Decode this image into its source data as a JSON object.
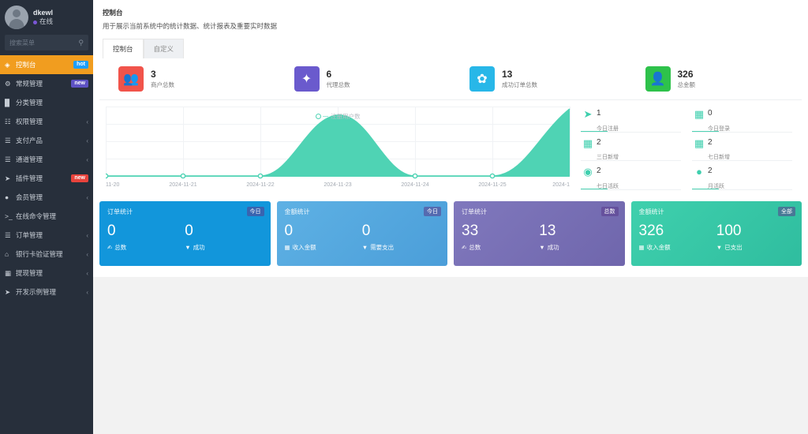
{
  "sidebar": {
    "user": {
      "name": "dkewl",
      "status": "在线",
      "status_color": "#7a56d6"
    },
    "search": {
      "placeholder": "搜索菜单",
      "icon": "search-icon"
    },
    "items": [
      {
        "label": "控制台",
        "icon": "dashboard-icon",
        "badge": "hot",
        "badge_type": "hot",
        "active": true,
        "caret": ""
      },
      {
        "label": "常规管理",
        "icon": "settings-icon",
        "badge": "new",
        "badge_type": "new-p",
        "active": false,
        "caret": ""
      },
      {
        "label": "分类管理",
        "icon": "tag-icon",
        "badge": "",
        "badge_type": "",
        "active": false,
        "caret": ""
      },
      {
        "label": "权限管理",
        "icon": "key-icon",
        "badge": "",
        "badge_type": "",
        "active": false,
        "caret": "‹"
      },
      {
        "label": "支付产品",
        "icon": "list-icon",
        "badge": "",
        "badge_type": "",
        "active": false,
        "caret": "‹"
      },
      {
        "label": "通道管理",
        "icon": "list-icon",
        "badge": "",
        "badge_type": "",
        "active": false,
        "caret": "‹"
      },
      {
        "label": "插件管理",
        "icon": "plugin-icon",
        "badge": "new",
        "badge_type": "new-r",
        "active": false,
        "caret": ""
      },
      {
        "label": "会员管理",
        "icon": "user-icon",
        "badge": "",
        "badge_type": "",
        "active": false,
        "caret": "‹"
      },
      {
        "label": "在线命令管理",
        "icon": "terminal-icon",
        "badge": "",
        "badge_type": "",
        "active": false,
        "caret": ""
      },
      {
        "label": "订单管理",
        "icon": "list-icon",
        "badge": "",
        "badge_type": "",
        "active": false,
        "caret": "‹"
      },
      {
        "label": "银行卡验证管理",
        "icon": "bank-icon",
        "badge": "",
        "badge_type": "",
        "active": false,
        "caret": "‹"
      },
      {
        "label": "提现管理",
        "icon": "card-icon",
        "badge": "",
        "badge_type": "",
        "active": false,
        "caret": "‹"
      },
      {
        "label": "开发示例管理",
        "icon": "code-icon",
        "badge": "",
        "badge_type": "",
        "active": false,
        "caret": "‹"
      }
    ]
  },
  "header": {
    "title": "控制台",
    "description": "用于展示当前系统中的统计数据、统计报表及重要实时数据",
    "tabs": [
      {
        "label": "控制台",
        "active": true
      },
      {
        "label": "自定义",
        "active": false
      }
    ]
  },
  "stats": [
    {
      "value": "3",
      "label": "商户总数",
      "icon": "users-icon",
      "color": "#f1544b"
    },
    {
      "value": "6",
      "label": "代理总数",
      "icon": "magic-icon",
      "color": "#6a5acd"
    },
    {
      "value": "13",
      "label": "成功订单总数",
      "icon": "leaf-icon",
      "color": "#28b7e8"
    },
    {
      "value": "326",
      "label": "总金额",
      "icon": "person-icon",
      "color": "#2ec24b"
    }
  ],
  "side_stats": [
    {
      "value": "1",
      "label": "今日注册",
      "icon": "rocket-icon"
    },
    {
      "value": "0",
      "label": "今日登录",
      "icon": "idcard-icon"
    },
    {
      "value": "2",
      "label": "三日新增",
      "icon": "calendar-icon"
    },
    {
      "value": "2",
      "label": "七日新增",
      "icon": "calendar-plus-icon"
    },
    {
      "value": "2",
      "label": "七日活跃",
      "icon": "user-circle-icon"
    },
    {
      "value": "2",
      "label": "月活跃",
      "icon": "user-filled-icon"
    }
  ],
  "bottom_cards": [
    {
      "title": "订单统计",
      "tag": "今日",
      "color": "#1296db",
      "gradient": "linear-gradient(135deg,#1296db,#1296db)",
      "left": {
        "value": "0",
        "label": "总数",
        "icon": "order-icon"
      },
      "right": {
        "value": "0",
        "label": "成功",
        "icon": "filter-icon"
      }
    },
    {
      "title": "金额统计",
      "tag": "今日",
      "color": "#54a7e0",
      "gradient": "linear-gradient(135deg,#5eb1e4,#4b9ed9)",
      "left": {
        "value": "0",
        "label": "收入金额",
        "icon": "money-icon"
      },
      "right": {
        "value": "0",
        "label": "需要支出",
        "icon": "filter-icon"
      }
    },
    {
      "title": "订单统计",
      "tag": "总数",
      "color": "#7a72b5",
      "gradient": "linear-gradient(135deg,#8078bd,#6f66ac)",
      "left": {
        "value": "33",
        "label": "总数",
        "icon": "order-icon"
      },
      "right": {
        "value": "13",
        "label": "成功",
        "icon": "filter-icon"
      }
    },
    {
      "title": "金额统计",
      "tag": "全部",
      "color": "#36c6a8",
      "gradient": "linear-gradient(135deg,#3fd0ad,#2fbd9f)",
      "left": {
        "value": "326",
        "label": "收入金额",
        "icon": "image-icon"
      },
      "right": {
        "value": "100",
        "label": "已支出",
        "icon": "filter-icon"
      }
    }
  ],
  "chart_data": {
    "type": "area",
    "title": "",
    "legend": "注册用户数",
    "legend_position": "top-center",
    "xlabel": "",
    "ylabel": "",
    "grid": true,
    "categories": [
      "11-20",
      "2024-11-21",
      "2024-11-22",
      "2024-11-23",
      "2024-11-24",
      "2024-11-25",
      "2024-1"
    ],
    "values": [
      0,
      0,
      0,
      2,
      0,
      0,
      2
    ],
    "ylim": [
      0,
      2
    ],
    "series": [
      {
        "name": "注册用户数",
        "values": [
          0,
          0,
          0,
          2,
          0,
          0,
          2
        ],
        "color": "#4fd3b4",
        "fill": "#4fd3b4"
      }
    ]
  }
}
